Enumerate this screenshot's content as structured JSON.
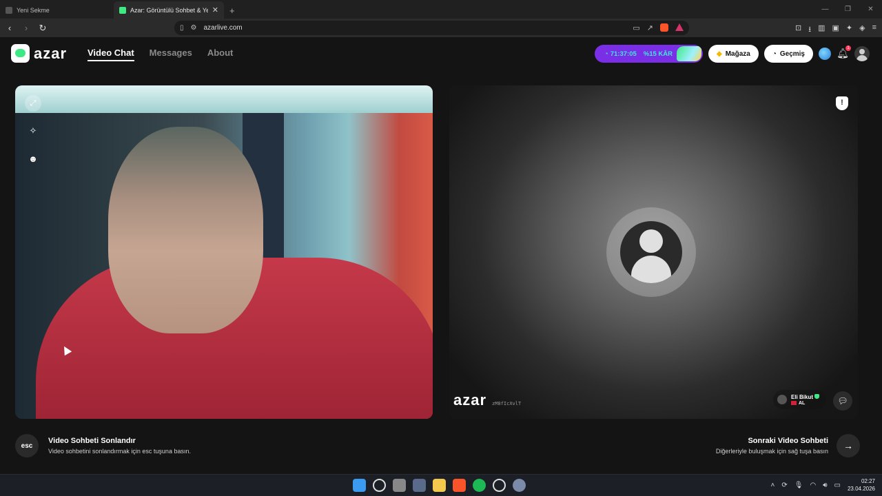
{
  "browser": {
    "tabs": [
      {
        "title": "Yeni Sekme",
        "active": false
      },
      {
        "title": "Azar: Görüntülü Sohbet & Yer",
        "active": true
      }
    ],
    "url": "azarlive.com"
  },
  "header": {
    "logo": "azar",
    "nav": [
      {
        "label": "Video Chat",
        "active": true
      },
      {
        "label": "Messages",
        "active": false
      },
      {
        "label": "About",
        "active": false
      }
    ],
    "promo": {
      "timer": "71:37:05",
      "offer": "%15 KÂR"
    },
    "store_label": "Mağaza",
    "history_label": "Geçmiş",
    "notification_count": "1"
  },
  "peer": {
    "watermark": "azar",
    "session_id": "zM8fIcXvlT",
    "name": "Eli Bikut",
    "country": "AL"
  },
  "footer": {
    "esc_key": "esc",
    "end_title": "Video Sohbeti Sonlandır",
    "end_hint": "Video sohbetini sonlandırmak için esc tuşuna basın.",
    "next_title": "Sonraki Video Sohbeti",
    "next_hint": "Diğerleriyle buluşmak için sağ tuşa basın"
  },
  "taskbar": {
    "time": "02:27",
    "date": "23.04.2026"
  },
  "colors": {
    "brand_green": "#3ee882",
    "promo_purple": "#7a2fe6",
    "background": "#141414"
  }
}
